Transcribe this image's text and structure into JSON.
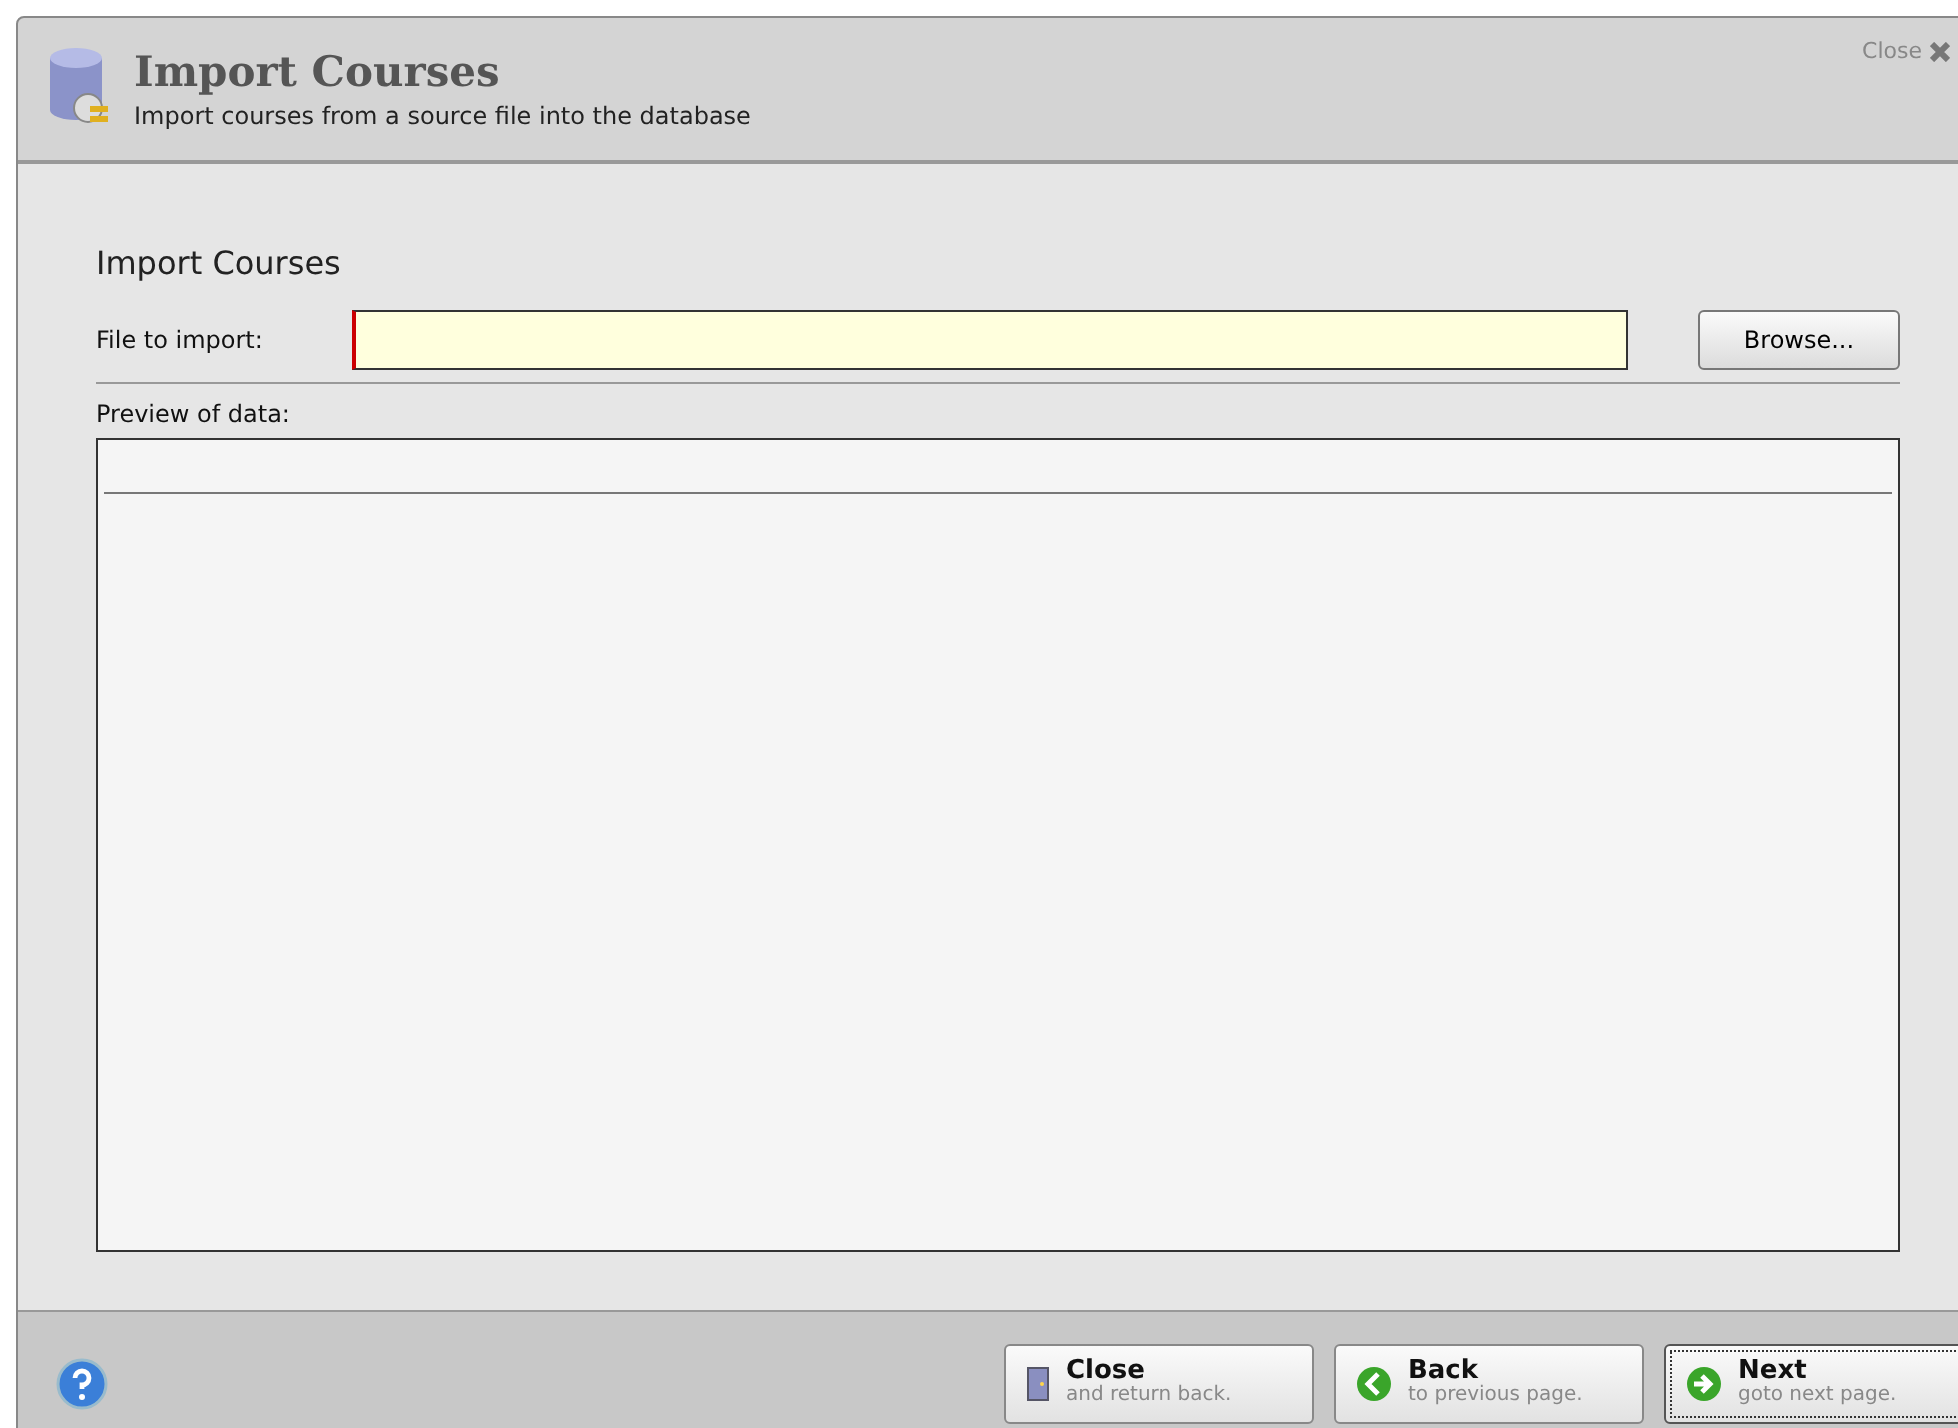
{
  "window": {
    "title": "Import Courses",
    "subtitle": "Import courses from a source file into the database",
    "close_label": "Close"
  },
  "form": {
    "heading": "Import Courses",
    "file_label": "File to import:",
    "browse_label": "Browse...",
    "preview_label": "Preview of data:"
  },
  "footer": {
    "buttons": [
      {
        "kind": "door",
        "title": "Close",
        "subtitle": "and return back.",
        "focused": false
      },
      {
        "kind": "back",
        "title": "Back",
        "subtitle": "to previous page.",
        "focused": false
      },
      {
        "kind": "next",
        "title": "Next",
        "subtitle": "goto next page.",
        "focused": true
      }
    ]
  }
}
